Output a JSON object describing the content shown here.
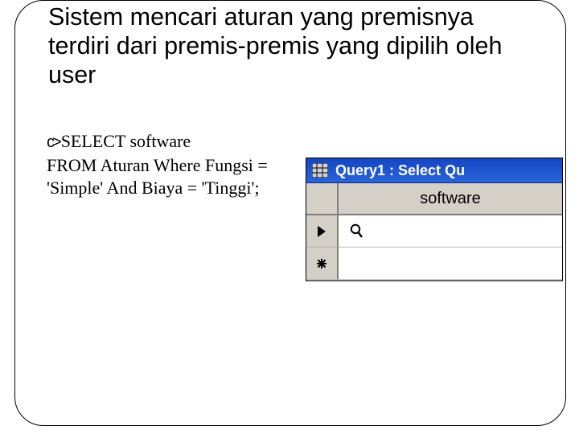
{
  "title": "Sistem mencari aturan yang premisnya terdiri dari premis-premis yang dipilih oleh user",
  "bullet": {
    "first_line": "SELECT software",
    "rest": "FROM Aturan Where Fungsi = 'Simple' And Biaya = 'Tinggi';"
  },
  "query_window": {
    "caption": "Query1 : Select Qu",
    "column_header": "software",
    "rows": [
      {
        "marker": "current",
        "value": ""
      },
      {
        "marker": "new",
        "value": ""
      }
    ]
  }
}
